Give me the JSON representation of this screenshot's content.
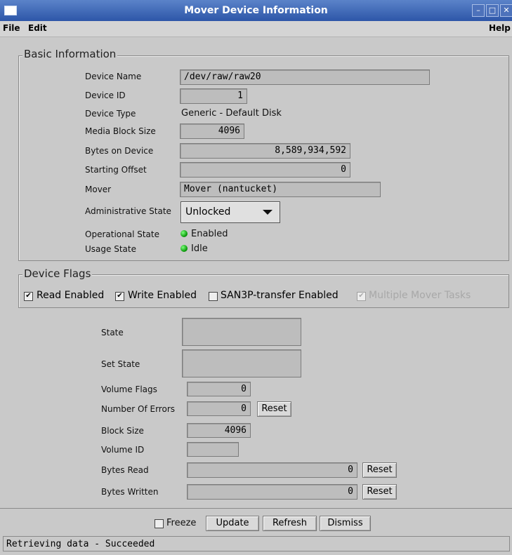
{
  "window": {
    "title": "Mover Device Information"
  },
  "menu": {
    "file": "File",
    "edit": "Edit",
    "help": "Help"
  },
  "basic": {
    "legend": "Basic Information",
    "device_name_label": "Device Name",
    "device_name": "/dev/raw/raw20",
    "device_id_label": "Device ID",
    "device_id": "1",
    "device_type_label": "Device Type",
    "device_type": "Generic - Default Disk",
    "media_block_size_label": "Media Block Size",
    "media_block_size": "4096",
    "bytes_on_device_label": "Bytes on Device",
    "bytes_on_device": "8,589,934,592",
    "starting_offset_label": "Starting Offset",
    "starting_offset": "0",
    "mover_label": "Mover",
    "mover": "Mover (nantucket)",
    "admin_state_label": "Administrative State",
    "admin_state": "Unlocked",
    "op_state_label": "Operational State",
    "op_state": "Enabled",
    "usage_state_label": "Usage State",
    "usage_state": "Idle",
    "status_led_color": "#0a9a0a"
  },
  "flags": {
    "legend": "Device Flags",
    "read_enabled": {
      "label": "Read Enabled",
      "checked": true
    },
    "write_enabled": {
      "label": "Write Enabled",
      "checked": true
    },
    "san3p": {
      "label": "SAN3P-transfer Enabled",
      "checked": false
    },
    "multiple_mover": {
      "label": "Multiple Mover Tasks",
      "checked": true,
      "disabled": true
    }
  },
  "details": {
    "state_label": "State",
    "state": "",
    "set_state_label": "Set State",
    "set_state": "",
    "volume_flags_label": "Volume Flags",
    "volume_flags": "0",
    "errors_label": "Number Of Errors",
    "errors": "0",
    "block_size_label": "Block Size",
    "block_size": "4096",
    "volume_id_label": "Volume ID",
    "volume_id": "",
    "bytes_read_label": "Bytes Read",
    "bytes_read": "0",
    "bytes_written_label": "Bytes Written",
    "bytes_written": "0",
    "reset_label": "Reset"
  },
  "footer": {
    "freeze": "Freeze",
    "update": "Update",
    "refresh": "Refresh",
    "dismiss": "Dismiss"
  },
  "status": "Retrieving data - Succeeded"
}
